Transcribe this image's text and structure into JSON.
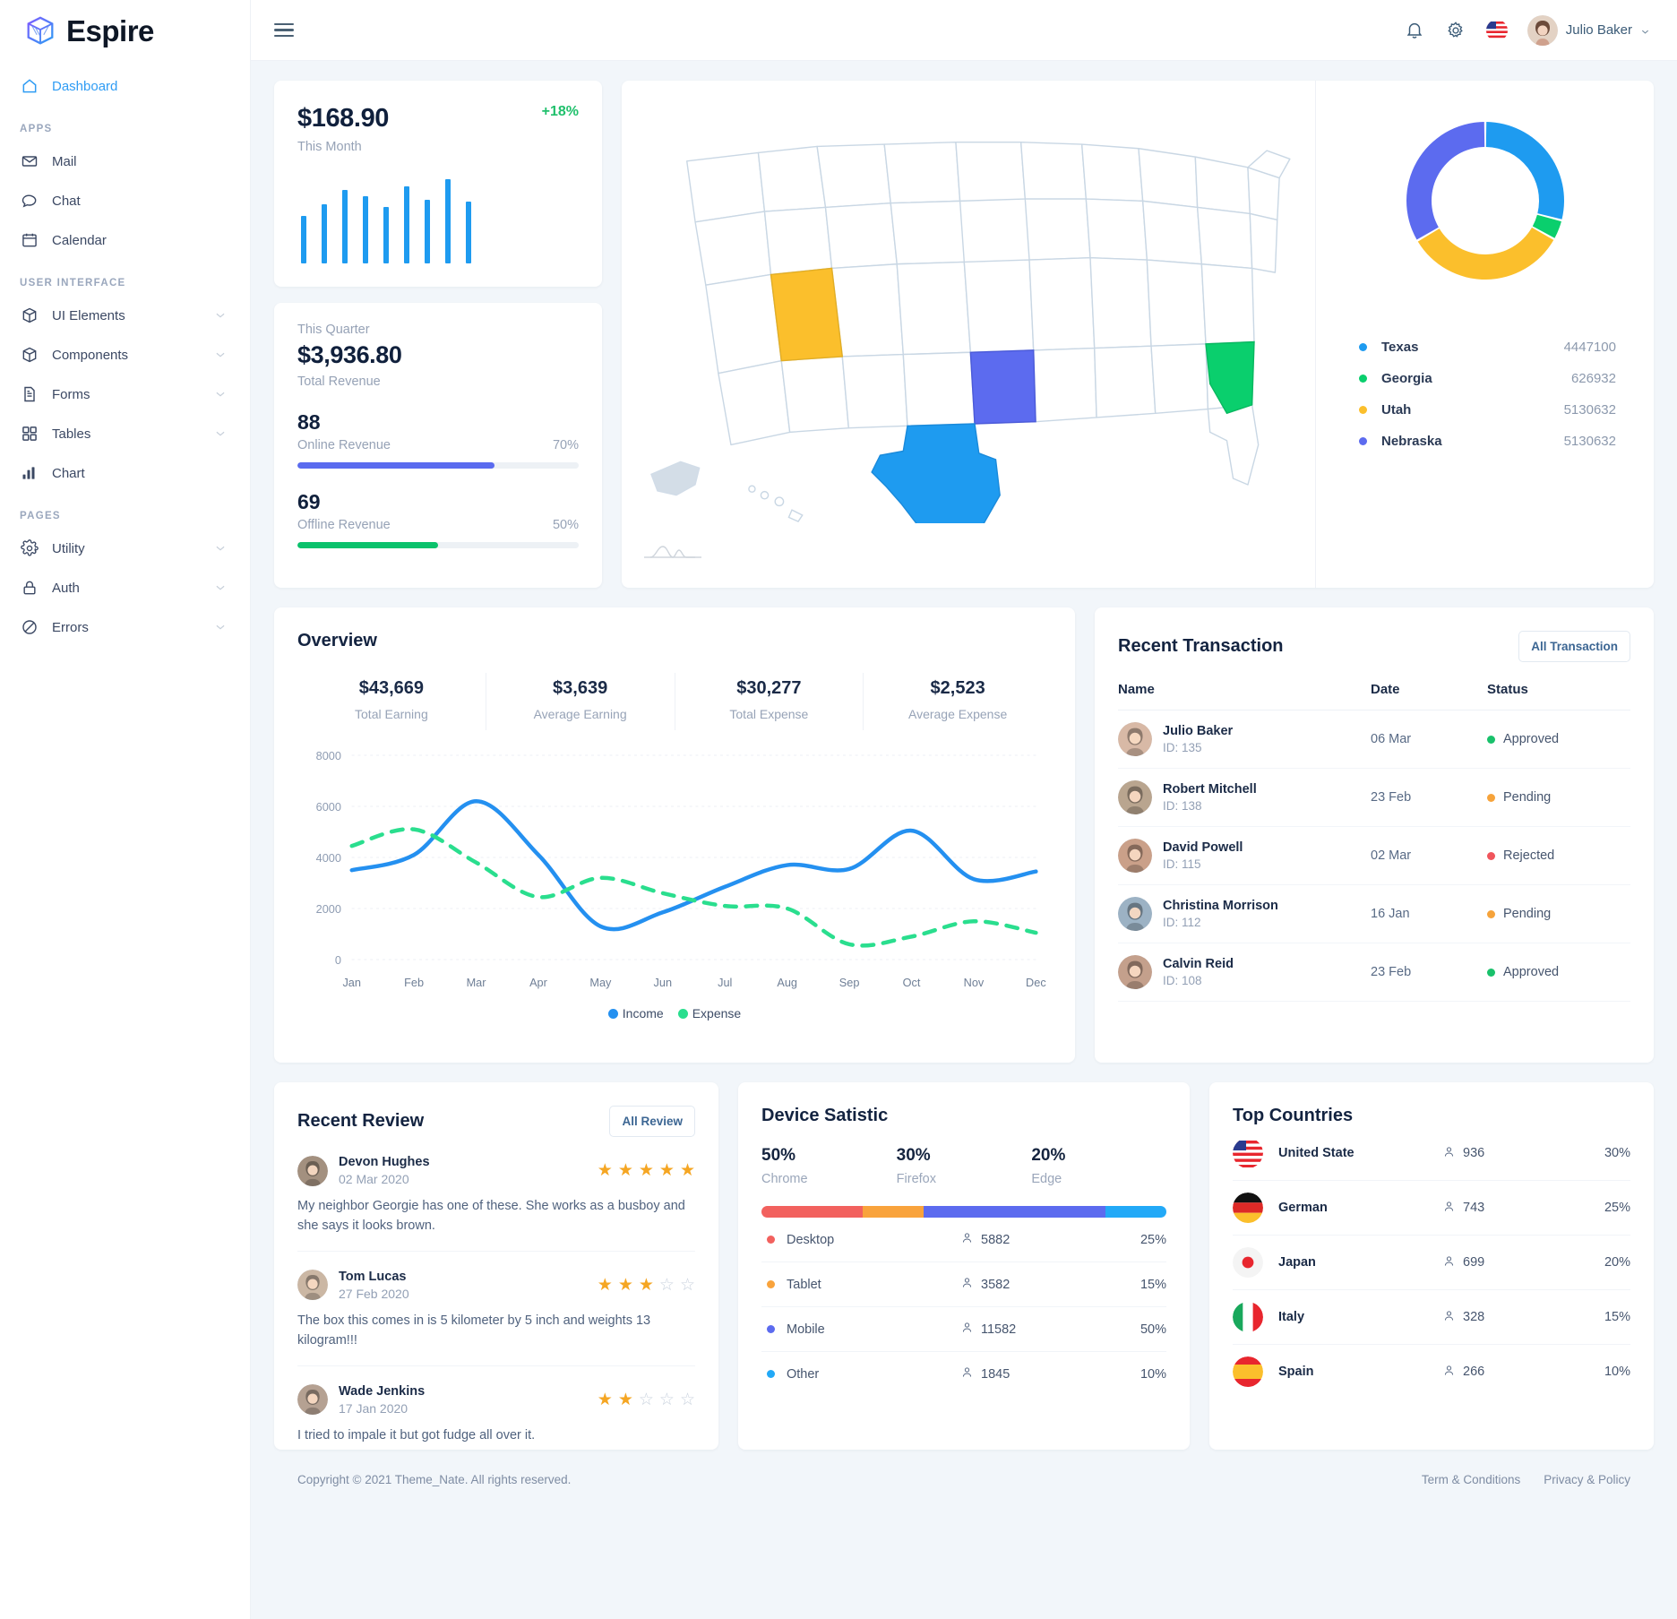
{
  "brand": {
    "name": "Espire",
    "logo_icon": "cube-logo-icon"
  },
  "sidebar": {
    "items": [
      {
        "label": "Dashboard",
        "icon": "home-icon",
        "active": true
      },
      {
        "label": "Mail",
        "icon": "mail-icon"
      },
      {
        "label": "Chat",
        "icon": "chat-icon"
      },
      {
        "label": "Calendar",
        "icon": "calendar-icon"
      },
      {
        "label": "UI Elements",
        "icon": "cube-icon",
        "caret": true
      },
      {
        "label": "Components",
        "icon": "cube-icon",
        "caret": true
      },
      {
        "label": "Forms",
        "icon": "document-icon",
        "caret": true
      },
      {
        "label": "Tables",
        "icon": "grid-icon",
        "caret": true
      },
      {
        "label": "Chart",
        "icon": "bar-chart-icon"
      },
      {
        "label": "Utility",
        "icon": "gear-icon",
        "caret": true
      },
      {
        "label": "Auth",
        "icon": "lock-icon",
        "caret": true
      },
      {
        "label": "Errors",
        "icon": "ban-icon",
        "caret": true
      }
    ],
    "sections": {
      "apps": "APPS",
      "user_interface": "USER INTERFACE",
      "pages": "PAGES"
    }
  },
  "topbar": {
    "menu_icon": "hamburger-icon",
    "notification_icon": "bell-icon",
    "settings_icon": "gear-icon",
    "language_flag": "us-flag-icon",
    "user_name": "Julio Baker"
  },
  "month_card": {
    "amount": "$168.90",
    "label": "This Month",
    "delta": "+18%",
    "bar_values": [
      52,
      65,
      80,
      74,
      62,
      84,
      70,
      92,
      68
    ],
    "bar_color": "#1e9bf0"
  },
  "quarter_card": {
    "period": "This Quarter",
    "amount": "$3,936.80",
    "sub": "Total Revenue",
    "metrics": [
      {
        "value": "88",
        "name": "Online Revenue",
        "pct": "70%",
        "pct_num": 70,
        "color": "#5a6bef"
      },
      {
        "value": "69",
        "name": "Offline Revenue",
        "pct": "50%",
        "pct_num": 50,
        "color": "#0ac26c"
      }
    ]
  },
  "map_card": {
    "states": [
      {
        "name": "Texas",
        "color": "#1e9bf0"
      },
      {
        "name": "Utah",
        "color": "#fbbf2c"
      },
      {
        "name": "Nebraska",
        "color": "#5c6bef"
      },
      {
        "name": "Georgia",
        "color": "#0acf6d"
      }
    ]
  },
  "chart_data": [
    {
      "type": "pie",
      "title": "State Distribution",
      "labels": [
        "Texas",
        "Georgia",
        "Utah",
        "Nebraska"
      ],
      "values": [
        4447100,
        626932,
        5130632,
        5130632
      ],
      "display_values": [
        "4447100",
        "626932",
        "5130632",
        "5130632"
      ],
      "colors": [
        "#1e9bf0",
        "#0acf6d",
        "#fbbf2c",
        "#5c6bef"
      ],
      "legend_position": "bottom",
      "donut": true
    },
    {
      "type": "line",
      "title": "Overview",
      "x": [
        "Jan",
        "Feb",
        "Mar",
        "Apr",
        "May",
        "Jun",
        "Jul",
        "Aug",
        "Sep",
        "Oct",
        "Nov",
        "Dec"
      ],
      "xlabel": "",
      "ylabel": "",
      "ylim": [
        0,
        8000
      ],
      "yticks": [
        0,
        2000,
        4000,
        6000,
        8000
      ],
      "grid": true,
      "legend_position": "bottom",
      "series": [
        {
          "name": "Income",
          "color": "#2490f0",
          "style": "solid",
          "values": [
            3500,
            4100,
            6200,
            4100,
            1300,
            1850,
            2850,
            3700,
            3550,
            5050,
            3150,
            3450
          ]
        },
        {
          "name": "Expense",
          "color": "#2ade8e",
          "style": "dashed",
          "values": [
            4450,
            5100,
            3800,
            2450,
            3200,
            2600,
            2100,
            2000,
            600,
            900,
            1500,
            1050
          ]
        }
      ]
    },
    {
      "type": "bar",
      "title": "Device Satistic",
      "categories": [
        "Desktop",
        "Tablet",
        "Mobile",
        "Other"
      ],
      "values": [
        25,
        15,
        50,
        10
      ],
      "counts": [
        5882,
        3582,
        11582,
        1845
      ],
      "colors": [
        "#f2615e",
        "#f9a33c",
        "#5c6bef",
        "#22a9f7"
      ],
      "ylabel": "%"
    }
  ],
  "overview": {
    "title": "Overview",
    "stats": [
      {
        "value": "$43,669",
        "label": "Total Earning"
      },
      {
        "value": "$3,639",
        "label": "Average Earning"
      },
      {
        "value": "$30,277",
        "label": "Total Expense"
      },
      {
        "value": "$2,523",
        "label": "Average Expense"
      }
    ]
  },
  "transactions": {
    "title": "Recent Transaction",
    "button": "All Transaction",
    "columns": {
      "name": "Name",
      "date": "Date",
      "status": "Status"
    },
    "rows": [
      {
        "name": "Julio Baker",
        "id": "ID: 135",
        "date": "06 Mar",
        "status": "Approved",
        "status_color": "#19c16b",
        "avatar": "#d8b9a6"
      },
      {
        "name": "Robert Mitchell",
        "id": "ID: 138",
        "date": "23 Feb",
        "status": "Pending",
        "status_color": "#f6a33b",
        "avatar": "#b9a58f"
      },
      {
        "name": "David Powell",
        "id": "ID: 115",
        "date": "02 Mar",
        "status": "Rejected",
        "status_color": "#f0555c",
        "avatar": "#caa089"
      },
      {
        "name": "Christina Morrison",
        "id": "ID: 112",
        "date": "16 Jan",
        "status": "Pending",
        "status_color": "#f6a33b",
        "avatar": "#9cb2c4"
      },
      {
        "name": "Calvin Reid",
        "id": "ID: 108",
        "date": "23 Feb",
        "status": "Approved",
        "status_color": "#19c16b",
        "avatar": "#c4a08c"
      }
    ]
  },
  "reviews": {
    "title": "Recent Review",
    "button": "All Review",
    "items": [
      {
        "name": "Devon Hughes",
        "date": "02 Mar 2020",
        "rating": 5,
        "text": "My neighbor Georgie has one of these. She works as a busboy and she says it looks brown.",
        "avatar": "#a3907f"
      },
      {
        "name": "Tom Lucas",
        "date": "27 Feb 2020",
        "rating": 3,
        "text": "The box this comes in is 5 kilometer by 5 inch and weights 13 kilogram!!!",
        "avatar": "#cbb7a4"
      },
      {
        "name": "Wade Jenkins",
        "date": "17 Jan 2020",
        "rating": 2,
        "text": "I tried to impale it but got fudge all over it.",
        "avatar": "#b5a192"
      }
    ]
  },
  "device": {
    "title": "Device Satistic",
    "browsers": [
      {
        "pct": "50%",
        "name": "Chrome"
      },
      {
        "pct": "30%",
        "name": "Firefox"
      },
      {
        "pct": "20%",
        "name": "Edge"
      }
    ],
    "stack": [
      {
        "color": "#f2615e",
        "width": 25
      },
      {
        "color": "#f9a33c",
        "width": 15
      },
      {
        "color": "#5c6bef",
        "width": 45
      },
      {
        "color": "#22a9f7",
        "width": 15
      }
    ],
    "rows": [
      {
        "name": "Desktop",
        "count": "5882",
        "pct": "25%",
        "color": "#f2615e"
      },
      {
        "name": "Tablet",
        "count": "3582",
        "pct": "15%",
        "color": "#f9a33c"
      },
      {
        "name": "Mobile",
        "count": "11582",
        "pct": "50%",
        "color": "#5c6bef"
      },
      {
        "name": "Other",
        "count": "1845",
        "pct": "10%",
        "color": "#22a9f7"
      }
    ]
  },
  "countries": {
    "title": "Top Countries",
    "rows": [
      {
        "name": "United State",
        "count": "936",
        "pct": "30%",
        "flag": "us-flag-icon"
      },
      {
        "name": "German",
        "count": "743",
        "pct": "25%",
        "flag": "de-flag-icon"
      },
      {
        "name": "Japan",
        "count": "699",
        "pct": "20%",
        "flag": "jp-flag-icon"
      },
      {
        "name": "Italy",
        "count": "328",
        "pct": "15%",
        "flag": "it-flag-icon"
      },
      {
        "name": "Spain",
        "count": "266",
        "pct": "10%",
        "flag": "es-flag-icon"
      }
    ]
  },
  "footer": {
    "copyright": "Copyright © 2021 Theme_Nate. All rights reserved.",
    "links": [
      "Term & Conditions",
      "Privacy & Policy"
    ]
  }
}
